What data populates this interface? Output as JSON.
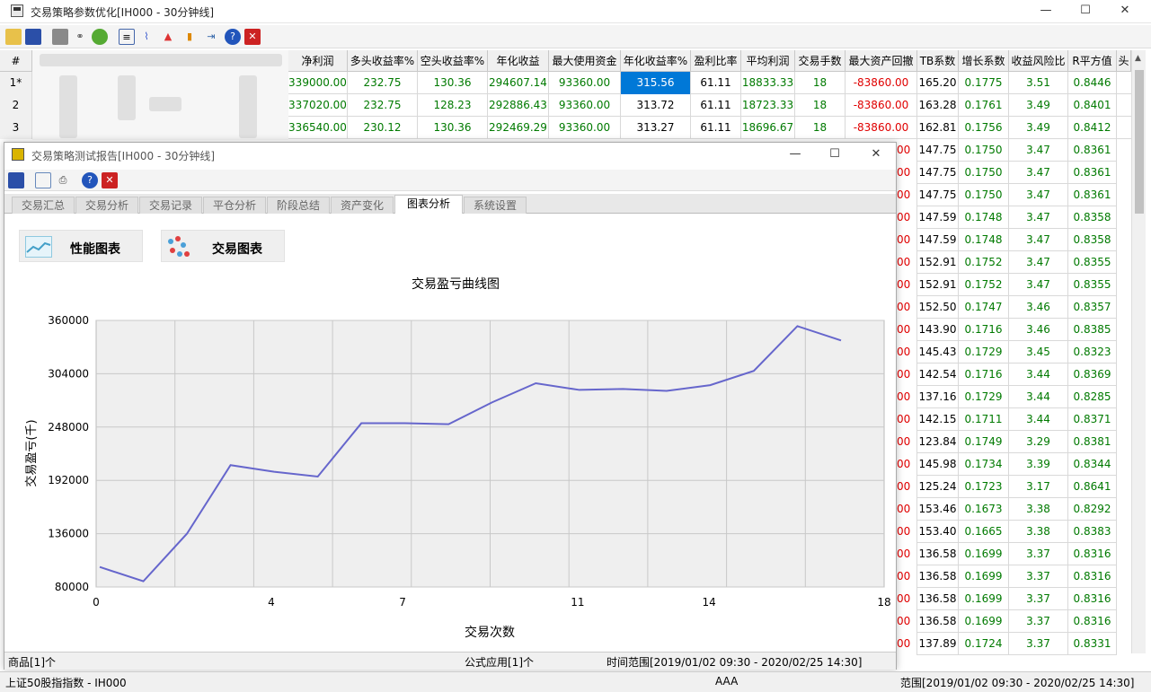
{
  "window": {
    "title": "交易策略参数优化[IH000 - 30分钟线]"
  },
  "grid": {
    "headers": [
      "#",
      "净利润",
      "多头收益率%",
      "空头收益率%",
      "年化收益",
      "最大使用资金",
      "年化收益率%",
      "盈利比率",
      "平均利润",
      "交易手数",
      "最大资产回撤",
      "TB系数",
      "增长系数",
      "收益风险比",
      "R平方值",
      "头"
    ],
    "rows": [
      [
        "1*",
        "339000.00",
        "232.75",
        "130.36",
        "294607.14",
        "93360.00",
        "315.56",
        "61.11",
        "18833.33",
        "18",
        "-83860.00",
        "165.20",
        "0.1775",
        "3.51",
        "0.8446"
      ],
      [
        "2",
        "337020.00",
        "232.75",
        "128.23",
        "292886.43",
        "93360.00",
        "313.72",
        "61.11",
        "18723.33",
        "18",
        "-83860.00",
        "163.28",
        "0.1761",
        "3.49",
        "0.8401"
      ],
      [
        "3",
        "336540.00",
        "230.12",
        "130.36",
        "292469.29",
        "93360.00",
        "313.27",
        "61.11",
        "18696.67",
        "18",
        "-83860.00",
        "162.81",
        "0.1756",
        "3.49",
        "0.8412"
      ]
    ],
    "right_rows": [
      [
        "147.75",
        "0.1750",
        "3.47",
        "0.8361"
      ],
      [
        "147.75",
        "0.1750",
        "3.47",
        "0.8361"
      ],
      [
        "147.75",
        "0.1750",
        "3.47",
        "0.8361"
      ],
      [
        "147.59",
        "0.1748",
        "3.47",
        "0.8358"
      ],
      [
        "147.59",
        "0.1748",
        "3.47",
        "0.8358"
      ],
      [
        "152.91",
        "0.1752",
        "3.47",
        "0.8355"
      ],
      [
        "152.91",
        "0.1752",
        "3.47",
        "0.8355"
      ],
      [
        "152.50",
        "0.1747",
        "3.46",
        "0.8357"
      ],
      [
        "143.90",
        "0.1716",
        "3.46",
        "0.8385"
      ],
      [
        "145.43",
        "0.1729",
        "3.45",
        "0.8323"
      ],
      [
        "142.54",
        "0.1716",
        "3.44",
        "0.8369"
      ],
      [
        "137.16",
        "0.1729",
        "3.44",
        "0.8285"
      ],
      [
        "142.15",
        "0.1711",
        "3.44",
        "0.8371"
      ],
      [
        "123.84",
        "0.1749",
        "3.29",
        "0.8381"
      ],
      [
        "145.98",
        "0.1734",
        "3.39",
        "0.8344"
      ],
      [
        "125.24",
        "0.1723",
        "3.17",
        "0.8641"
      ],
      [
        "153.46",
        "0.1673",
        "3.38",
        "0.8292"
      ],
      [
        "153.40",
        "0.1665",
        "3.38",
        "0.8383"
      ],
      [
        "136.58",
        "0.1699",
        "3.37",
        "0.8316"
      ],
      [
        "136.58",
        "0.1699",
        "3.37",
        "0.8316"
      ],
      [
        "136.58",
        "0.1699",
        "3.37",
        "0.8316"
      ],
      [
        "136.58",
        "0.1699",
        "3.37",
        "0.8316"
      ],
      [
        "137.89",
        "0.1724",
        "3.37",
        "0.8331"
      ]
    ],
    "right_prefix": "00"
  },
  "report": {
    "title": "交易策略测试报告[IH000 - 30分钟线]",
    "tabs": [
      "交易汇总",
      "交易分析",
      "交易记录",
      "平仓分析",
      "阶段总结",
      "资产变化",
      "图表分析",
      "系统设置"
    ],
    "active_tab": 6,
    "perf_button": "性能图表",
    "trade_button": "交易图表",
    "status_product": "商品[1]个",
    "status_formula": "公式应用[1]个",
    "status_range": "时间范围[2019/01/02 09:30 - 2020/02/25 14:30]"
  },
  "chart_data": {
    "type": "line",
    "title": "交易盈亏曲线图",
    "xlabel": "交易次数",
    "ylabel": "交易盈亏(千)",
    "xlim": [
      0,
      18
    ],
    "ylim": [
      80000,
      360000
    ],
    "xticks": [
      0,
      4,
      7,
      11,
      14,
      18
    ],
    "yticks": [
      80000,
      136000,
      192000,
      248000,
      304000,
      360000
    ],
    "x": [
      0,
      1.1,
      2.2,
      3.3,
      4.4,
      5.5,
      6.6,
      7.7,
      8.8,
      9.9,
      11.0,
      12.1,
      13.2,
      14.3,
      15.4,
      16.5,
      17.6
    ],
    "y": [
      101000,
      86000,
      136000,
      208000,
      201000,
      196000,
      252000,
      252000,
      251000,
      274000,
      294000,
      287000,
      288000,
      286000,
      292000,
      307000,
      354000,
      339000
    ],
    "color": "#6666cc",
    "grid": true
  },
  "status": {
    "index": "上证50股指指数 - IH000",
    "user": "AAA",
    "range": "范围[2019/01/02 09:30 - 2020/02/25 14:30]"
  }
}
